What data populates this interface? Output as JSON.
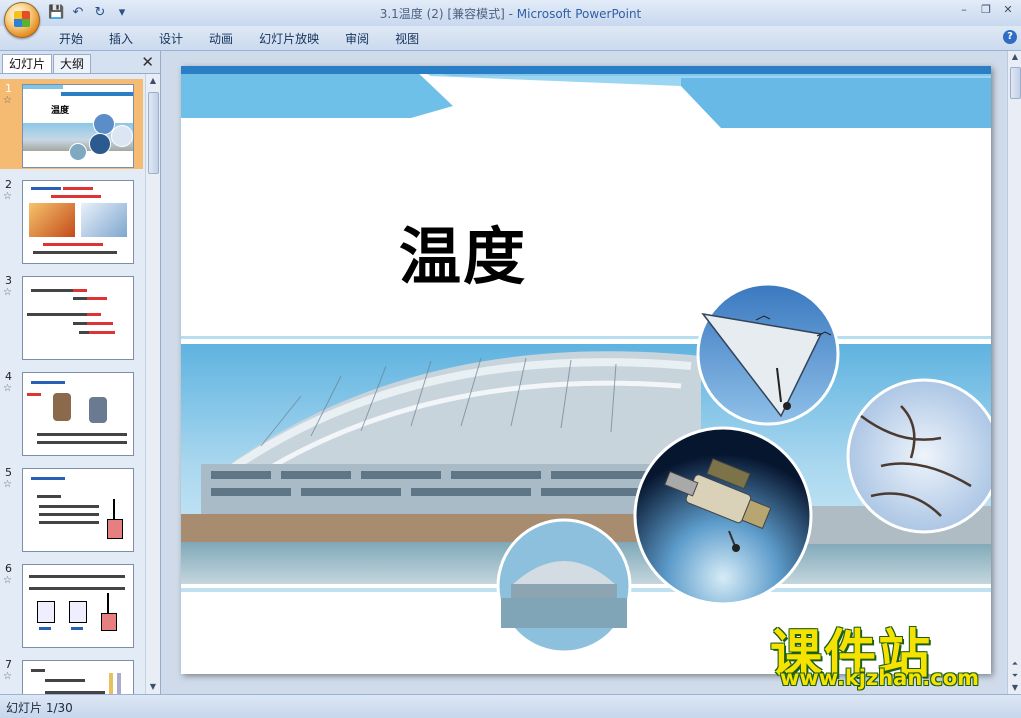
{
  "window": {
    "title_doc": "3.1温度 (2) [兼容模式] - ",
    "title_app": "Microsoft PowerPoint"
  },
  "quick_access": {
    "icons": [
      "save-icon",
      "undo-icon",
      "redo-icon",
      "customize-icon"
    ]
  },
  "ribbon": {
    "tabs": [
      "开始",
      "插入",
      "设计",
      "动画",
      "幻灯片放映",
      "审阅",
      "视图"
    ]
  },
  "left_panel": {
    "tab_slides": "幻灯片",
    "tab_outline": "大纲",
    "close_glyph": "✕",
    "thumbnails": [
      {
        "num": "1",
        "title": "温度"
      },
      {
        "num": "2"
      },
      {
        "num": "3"
      },
      {
        "num": "4"
      },
      {
        "num": "5"
      },
      {
        "num": "6"
      },
      {
        "num": "7"
      }
    ]
  },
  "slide": {
    "title": "温度"
  },
  "status_bar": {
    "slide_indicator": "幻灯片 1/30"
  },
  "watermark": {
    "brand": "课件站",
    "url": "www.kjzhan.com"
  },
  "colors": {
    "accent_blue": "#2a7ec6",
    "selected_thumb": "#f5bb73",
    "watermark_yellow": "#f6e200"
  }
}
